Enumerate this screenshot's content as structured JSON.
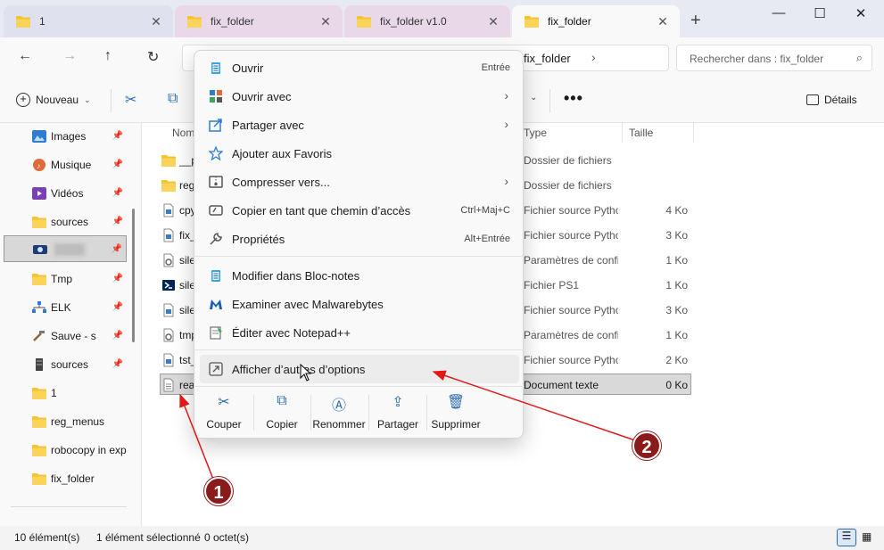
{
  "tabs": [
    {
      "label": "1"
    },
    {
      "label": "fix_folder"
    },
    {
      "label": "fix_folder v1.0"
    },
    {
      "label": "fix_folder"
    }
  ],
  "window": {
    "new_tab": "+",
    "minimize": "—",
    "maximize": "☐",
    "close": "✕"
  },
  "address": {
    "crumb": "fix_folder",
    "chevron": "›"
  },
  "search": {
    "placeholder": "Rechercher dans : fix_folder"
  },
  "toolbar": {
    "new_label": "Nouveau",
    "more": "•••",
    "details_label": "Détails"
  },
  "sidebar": {
    "items": [
      {
        "label": "Images",
        "icon": "images-icon",
        "pinned": true
      },
      {
        "label": "Musique",
        "icon": "music-icon",
        "pinned": true
      },
      {
        "label": "Vidéos",
        "icon": "videos-icon",
        "pinned": true
      },
      {
        "label": "sources",
        "icon": "folder-icon",
        "pinned": true
      },
      {
        "label": "",
        "icon": "drive-icon",
        "pinned": true
      },
      {
        "label": "Tmp",
        "icon": "folder-icon",
        "pinned": true
      },
      {
        "label": "ELK",
        "icon": "network-icon",
        "pinned": true
      },
      {
        "label": "Sauve - s",
        "icon": "tools-icon",
        "pinned": true
      },
      {
        "label": "sources",
        "icon": "server-icon",
        "pinned": true
      },
      {
        "label": "1",
        "icon": "folder-icon",
        "pinned": false
      },
      {
        "label": "reg_menus",
        "icon": "folder-icon",
        "pinned": false
      },
      {
        "label": "robocopy in exp",
        "icon": "folder-icon",
        "pinned": false
      },
      {
        "label": "fix_folder",
        "icon": "folder-icon",
        "pinned": false
      }
    ]
  },
  "filelist": {
    "headers": {
      "name": "Nom",
      "type": "Type",
      "size": "Taille"
    },
    "rows": [
      {
        "name": "__p",
        "type": "Dossier de fichiers",
        "size": "",
        "icon": "folder-icon"
      },
      {
        "name": "reg",
        "type": "Dossier de fichiers",
        "size": "",
        "icon": "folder-icon"
      },
      {
        "name": "cpy",
        "type": "Fichier source Python",
        "size": "4 Ko",
        "icon": "python-file-icon"
      },
      {
        "name": "fix_",
        "type": "Fichier source Python",
        "size": "3 Ko",
        "icon": "python-file-icon"
      },
      {
        "name": "sile",
        "type": "Paramètres de configuration",
        "size": "1 Ko",
        "icon": "config-file-icon"
      },
      {
        "name": "sile",
        "type": "Fichier PS1",
        "size": "1 Ko",
        "icon": "powershell-icon"
      },
      {
        "name": "sile",
        "type": "Fichier source Python",
        "size": "3 Ko",
        "icon": "python-file-icon"
      },
      {
        "name": "tmp",
        "type": "Paramètres de configuration",
        "size": "1 Ko",
        "icon": "config-file-icon"
      },
      {
        "name": "tst_",
        "type": "Fichier source Python",
        "size": "2 Ko",
        "icon": "python-file-icon"
      },
      {
        "name": "rea",
        "type": "Document texte",
        "size": "0 Ko",
        "icon": "text-file-icon",
        "selected": true
      }
    ]
  },
  "status": {
    "count": "10 élément(s)",
    "selected": "1 élément sélectionné",
    "bytes": "0 octet(s)"
  },
  "context_menu": {
    "items": [
      {
        "label": "Ouvrir",
        "shortcut": "Entrée",
        "icon": "notepad-icon"
      },
      {
        "label": "Ouvrir avec",
        "submenu": true,
        "icon": "open-with-icon"
      },
      {
        "label": "Partager avec",
        "submenu": true,
        "icon": "share-with-icon"
      },
      {
        "label": "Ajouter aux Favoris",
        "icon": "star-icon"
      },
      {
        "label": "Compresser vers...",
        "submenu": true,
        "icon": "zip-icon"
      },
      {
        "label": "Copier en tant que chemin d’accès",
        "shortcut": "Ctrl+Maj+C",
        "icon": "copy-path-icon"
      },
      {
        "label": "Propriétés",
        "shortcut": "Alt+Entrée",
        "icon": "wrench-icon"
      },
      {
        "label": "Modifier dans Bloc-notes",
        "icon": "notepad-icon"
      },
      {
        "label": "Examiner avec Malwarebytes",
        "icon": "malwarebytes-icon"
      },
      {
        "label": "Éditer avec Notepad++",
        "icon": "notepadpp-icon"
      },
      {
        "label": "Afficher d’autres d’options",
        "icon": "more-options-icon"
      }
    ],
    "actions": [
      {
        "label": "Couper",
        "icon": "scissors-icon"
      },
      {
        "label": "Copier",
        "icon": "copy-icon"
      },
      {
        "label": "Renommer",
        "icon": "rename-icon"
      },
      {
        "label": "Partager",
        "icon": "share-icon"
      },
      {
        "label": "Supprimer",
        "icon": "trash-icon"
      }
    ]
  },
  "annotations": {
    "badge1": "1",
    "badge2": "2"
  },
  "colors": {
    "accent": "#2b6cb0",
    "annotation": "#8b1a1a",
    "arrow": "#e01818",
    "folder": "#f4c430"
  }
}
